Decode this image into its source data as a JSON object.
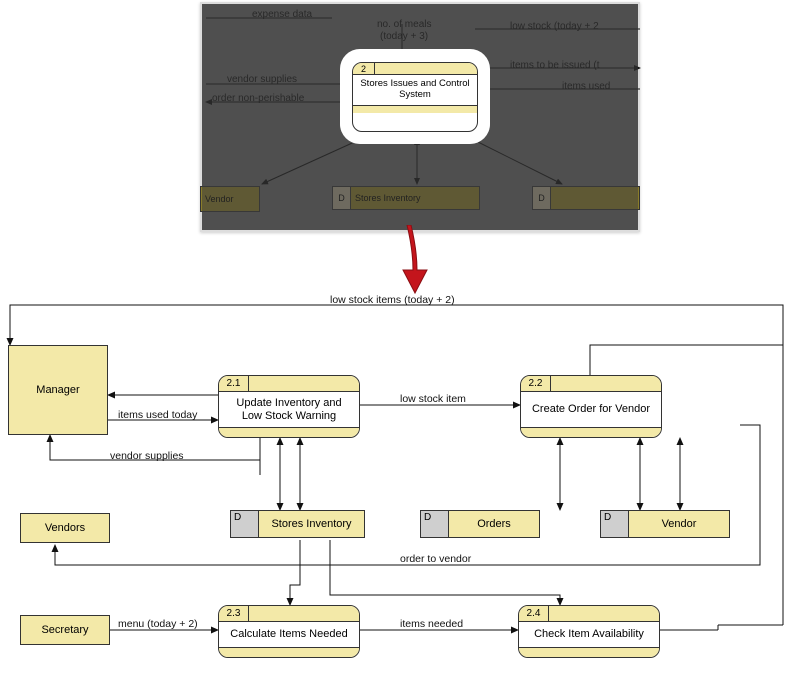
{
  "thumbnail": {
    "labels": {
      "expense": "expense data",
      "meals1": "no. of meals",
      "meals2": "(today + 3)",
      "lowstock": "low stock (today + 2",
      "itemsissued": "items to be issued (t",
      "itemsused": "items used",
      "vendorsupp": "vendor supplies",
      "ordernp": "order non-perishable"
    },
    "process": {
      "badge": "2",
      "name": "Stores Issues and Control System"
    },
    "ds": {
      "vendor": "Vendor",
      "stores": "Stores Inventory",
      "tag": "D"
    }
  },
  "actors": {
    "manager": "Manager",
    "vendors": "Vendors",
    "secretary": "Secretary"
  },
  "processes": {
    "p21": {
      "badge": "2.1",
      "name": "Update Inventory and Low Stock Warning"
    },
    "p22": {
      "badge": "2.2",
      "name": "Create Order for Vendor"
    },
    "p23": {
      "badge": "2.3",
      "name": "Calculate Items Needed"
    },
    "p24": {
      "badge": "2.4",
      "name": "Check Item Availability"
    }
  },
  "datastores": {
    "tag": "D",
    "stores": "Stores Inventory",
    "orders": "Orders",
    "vendor": "Vendor"
  },
  "flows": {
    "low_stock_top": "low stock items (today + 2)",
    "items_used": "items used today",
    "low_stock_item": "low stock item",
    "vendor_supplies": "vendor supplies",
    "order_to_vendor": "order to vendor",
    "menu": "menu (today + 2)",
    "items_needed": "items needed"
  }
}
